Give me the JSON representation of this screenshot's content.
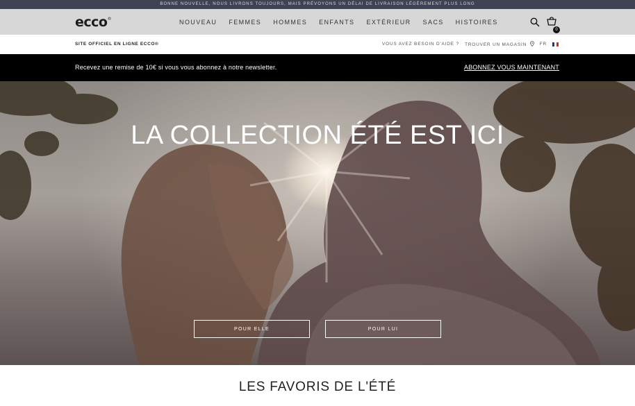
{
  "announcement": "BONNE NOUVELLE, NOUS LIVRONS TOUJOURS, MAIS PRÉVOYONS UN DÉLAI DE LIVRAISON LÉGÈREMENT PLUS LONG",
  "header": {
    "logo": "ecco",
    "logo_mark": "®",
    "nav": [
      "NOUVEAU",
      "FEMMES",
      "HOMMES",
      "ENFANTS",
      "EXTÉRIEUR",
      "SACS",
      "HISTOIRES"
    ],
    "cart_count": "0",
    "icons": {
      "search": "search-icon",
      "cart": "shopping-bag-icon"
    }
  },
  "utility": {
    "official": "SITE OFFICIEL EN LIGNE ECCO®",
    "help": "VOUS AVEZ BESOIN D'AIDE ?",
    "store": "TROUVER UN MAGASIN",
    "language": "FR",
    "icons": {
      "store": "location-pin-icon",
      "flag": "france-flag-icon"
    }
  },
  "newsletter": {
    "text": "Recevez une remise de 10€ si vous vous abonnez à notre newsletter.",
    "cta": "ABONNEZ VOUS MAINTENANT"
  },
  "hero": {
    "title": "LA COLLECTION ÉTÉ EST ICI",
    "buttons": {
      "her": "POUR ELLE",
      "him": "POUR LUI"
    }
  },
  "section": {
    "title": "LES FAVORIS DE L'ÉTÉ"
  },
  "colors": {
    "announce_bg": "#3d4352",
    "nav_bg": "#d7d7d7",
    "newsletter_bg": "#000000"
  }
}
